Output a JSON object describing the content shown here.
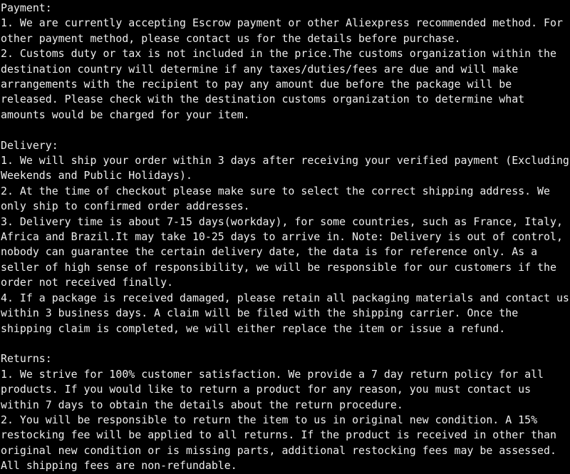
{
  "page": {
    "background_color": "#000000",
    "text_color": "#eeeeee",
    "title": "Payment / Delivery / Returns Policy"
  },
  "sections": [
    {
      "id": "payment",
      "heading": "Payment:",
      "items": [
        "1. We are currently accepting Escrow payment or other Aliexpress recommended method. For other payment method, please contact us for the details before purchase.",
        "2. Customs duty or tax is not included in the price.The customs organization within the destination country will determine if any taxes/duties/fees are due and will make arrangements with the recipient to pay any amount due before the package will be released. Please check with the destination customs organization to determine what amounts would be charged for your item."
      ]
    },
    {
      "id": "delivery",
      "heading": "Delivery:",
      "items": [
        "1. We will ship your order within 3 days after receiving your verified payment (Excluding Weekends and Public Holidays).",
        "2. At the time of checkout please make sure to select the correct shipping address. We only ship to confirmed order addresses.",
        "3. Delivery time is about 7-15 days(workday), for some countries, such as France, Italy, Africa and Brazil.It may take 10-25 days to arrive in. Note: Delivery is out of control, nobody can guarantee the certain delivery date, the data is for reference only. As a seller of high sense of responsibility, we will be responsible for our customers if the order not received finally.",
        "4. If a package is received damaged, please retain all packaging materials and contact us within 3 business days. A claim will be filed with the shipping carrier. Once the shipping claim is completed, we will either replace the item or issue a refund."
      ]
    },
    {
      "id": "returns",
      "heading": "Returns:",
      "items": [
        "1. We strive for 100% customer satisfaction. We provide a 7 day return policy for all products. If you would like to return a product for any reason, you must contact us within 7 days to obtain the details about the return procedure.",
        "2. You will be responsible to return the item to us in original new condition. A 15% restocking fee will be applied to all returns. If the product is received in other than original new condition or is missing parts, additional restocking fees may be assessed. All shipping fees are non-refundable."
      ]
    }
  ]
}
